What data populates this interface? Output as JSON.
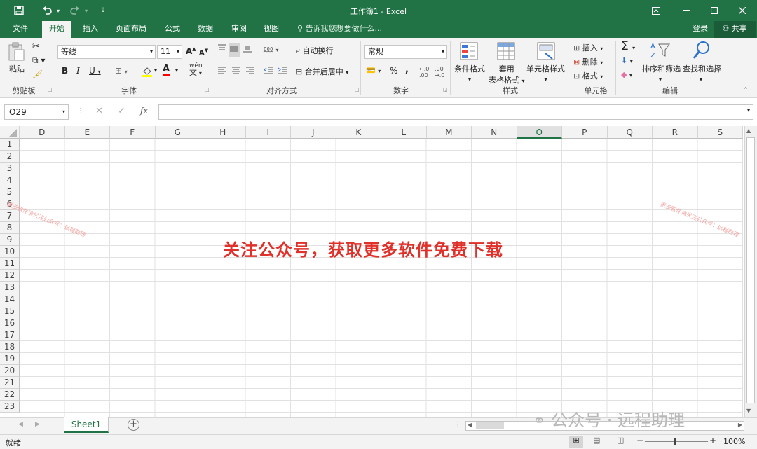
{
  "window": {
    "title": "工作簿1 - Excel"
  },
  "tabs": [
    "文件",
    "开始",
    "插入",
    "页面布局",
    "公式",
    "数据",
    "审阅",
    "视图"
  ],
  "active_tab": "开始",
  "tell_me": "告诉我您想要做什么...",
  "account": {
    "login": "登录",
    "share": "共享"
  },
  "clipboard": {
    "paste": "粘贴",
    "label": "剪贴板"
  },
  "font": {
    "name": "等线",
    "size": "11",
    "label": "字体",
    "bold": "B",
    "italic": "I",
    "underline": "U",
    "grow": "A",
    "shrink": "A",
    "font_color": "A",
    "wen": "wén",
    "wen_char": "文"
  },
  "alignment": {
    "wrap": "自动换行",
    "merge": "合并后居中",
    "label": "对齐方式"
  },
  "number": {
    "format": "常规",
    "percent": "%",
    "comma": ",",
    "label": "数字"
  },
  "styles": {
    "conditional": "条件格式",
    "table_line1": "套用",
    "table_line2": "表格格式",
    "cell_styles": "单元格样式",
    "label": "样式"
  },
  "cells": {
    "insert": "插入",
    "delete": "删除",
    "format": "格式",
    "label": "单元格"
  },
  "editing": {
    "sort": "排序和筛选",
    "find": "查找和选择",
    "label": "编辑"
  },
  "formula": {
    "name_box": "O29",
    "fx": "fx"
  },
  "columns": [
    "D",
    "E",
    "F",
    "G",
    "H",
    "I",
    "J",
    "K",
    "L",
    "M",
    "N",
    "O",
    "P",
    "Q",
    "R",
    "S"
  ],
  "selected_column": "O",
  "rows": [
    "1",
    "2",
    "3",
    "4",
    "5",
    "6",
    "7",
    "8",
    "9",
    "10",
    "11",
    "12",
    "13",
    "14",
    "15",
    "16",
    "17",
    "18",
    "19",
    "20",
    "21",
    "22",
    "23"
  ],
  "watermark": "关注公众号，获取更多软件免费下载",
  "watermark_small": "更多软件请关注公众号：远程助理",
  "sheet": {
    "name": "Sheet1"
  },
  "status": {
    "ready": "就绪",
    "zoom": "100%"
  },
  "bottom_watermark": "公众号 · 远程助理"
}
